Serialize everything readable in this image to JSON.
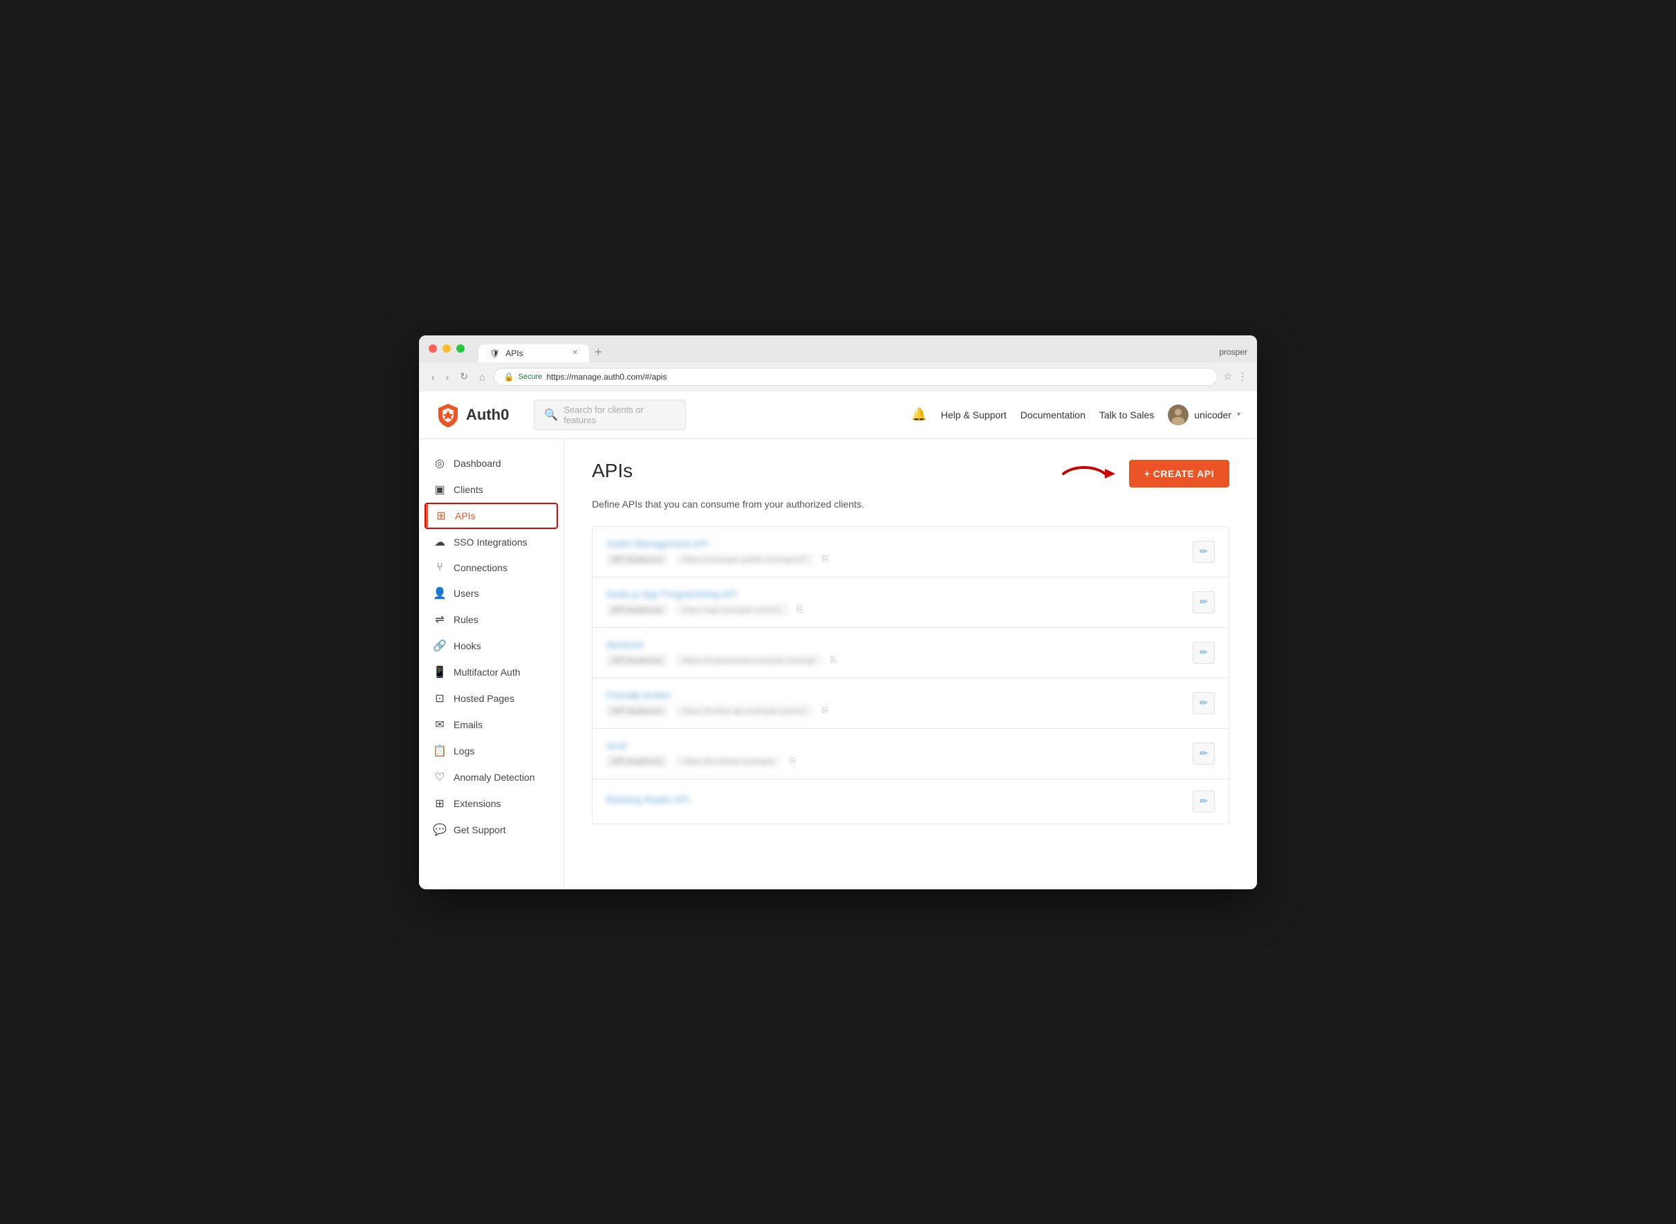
{
  "browser": {
    "tab_title": "APIs",
    "tab_favicon": "🛡",
    "url_secure": "Secure",
    "url": "https://manage.auth0.com/#/apis",
    "user_name": "prosper"
  },
  "header": {
    "logo_text": "Auth0",
    "search_placeholder": "Search for clients or features",
    "bell_icon": "🔔",
    "nav_links": [
      "Help & Support",
      "Documentation",
      "Talk to Sales"
    ],
    "user_name": "unicoder",
    "chevron": "▾"
  },
  "sidebar": {
    "items": [
      {
        "id": "dashboard",
        "label": "Dashboard",
        "icon": "◎"
      },
      {
        "id": "clients",
        "label": "Clients",
        "icon": "▣"
      },
      {
        "id": "apis",
        "label": "APIs",
        "icon": "⊞",
        "active": true
      },
      {
        "id": "sso-integrations",
        "label": "SSO Integrations",
        "icon": "☁"
      },
      {
        "id": "connections",
        "label": "Connections",
        "icon": "⑂"
      },
      {
        "id": "users",
        "label": "Users",
        "icon": "👤"
      },
      {
        "id": "rules",
        "label": "Rules",
        "icon": "⇌"
      },
      {
        "id": "hooks",
        "label": "Hooks",
        "icon": "🔗"
      },
      {
        "id": "multifactor-auth",
        "label": "Multifactor Auth",
        "icon": "📱"
      },
      {
        "id": "hosted-pages",
        "label": "Hosted Pages",
        "icon": "⊡"
      },
      {
        "id": "emails",
        "label": "Emails",
        "icon": "✉"
      },
      {
        "id": "logs",
        "label": "Logs",
        "icon": "📋"
      },
      {
        "id": "anomaly-detection",
        "label": "Anomaly Detection",
        "icon": "♡"
      },
      {
        "id": "extensions",
        "label": "Extensions",
        "icon": "⊞"
      },
      {
        "id": "get-support",
        "label": "Get Support",
        "icon": "💬"
      }
    ]
  },
  "page": {
    "title": "APIs",
    "description": "Define APIs that you can consume from your authorized clients.",
    "create_button": "+ CREATE API",
    "apis": [
      {
        "name": "Auth0 Management API",
        "identifier_label": "API Audience",
        "identifier_value": "https://example.auth0.com/api/v2/",
        "has_copy": true
      },
      {
        "name": "Node.js App Programming API",
        "identifier_label": "API Audience",
        "identifier_value": "https://api.example.com/v1",
        "has_copy": true
      },
      {
        "name": "backend",
        "identifier_label": "API Audience",
        "identifier_value": "https://mybackend.example.com/api",
        "has_copy": true
      },
      {
        "name": "Friendly broker",
        "identifier_label": "API Audience",
        "identifier_value": "https://broker.api.example.com/v1",
        "has_copy": true
      },
      {
        "name": "local",
        "identifier_label": "API Audience",
        "identifier_value": "https://localhost.example",
        "has_copy": true
      },
      {
        "name": "Banking Realm API",
        "identifier_label": "API Audience",
        "identifier_value": "",
        "has_copy": false
      }
    ]
  },
  "icons": {
    "search": "🔍",
    "edit": "✏",
    "copy": "📋",
    "plus": "+"
  }
}
